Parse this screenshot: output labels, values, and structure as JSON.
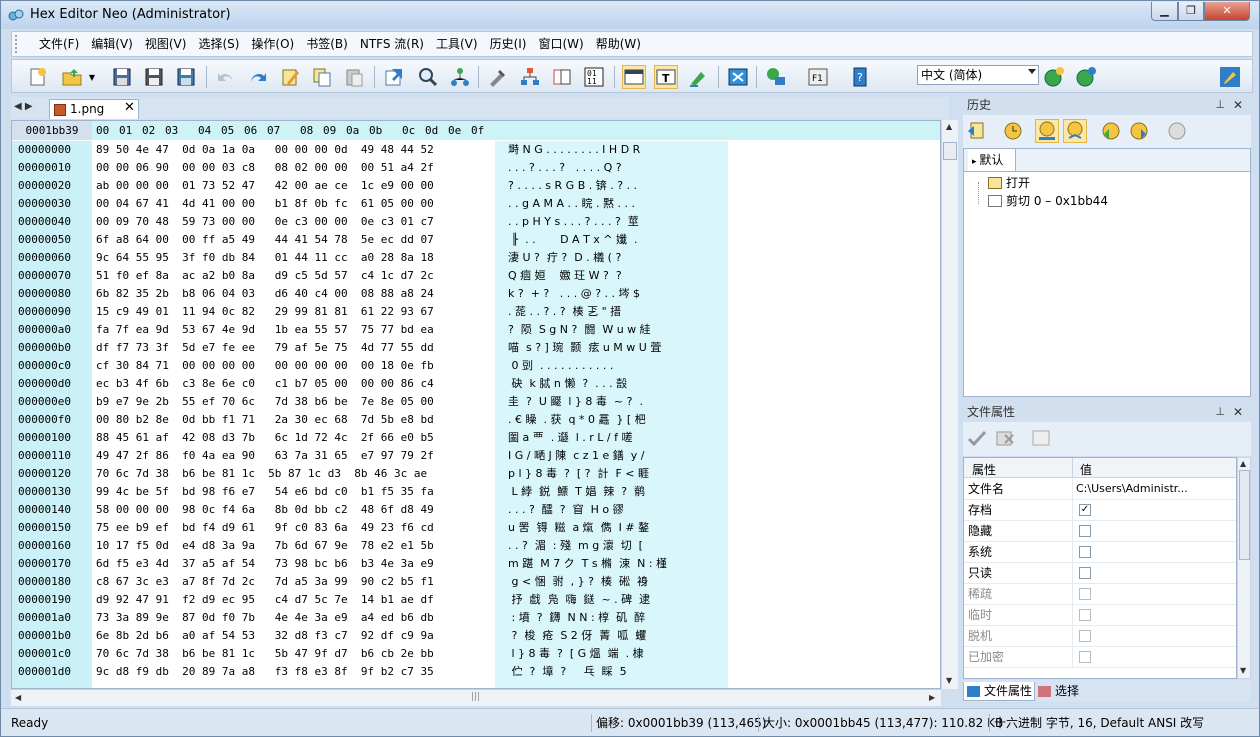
{
  "window": {
    "title": "Hex Editor Neo (Administrator)",
    "min": "0",
    "max": "1",
    "close": "r"
  },
  "menu": [
    "文件(F)",
    "编辑(V)",
    "视图(V)",
    "选择(S)",
    "操作(O)",
    "书签(B)",
    "NTFS 流(R)",
    "工具(V)",
    "历史(I)",
    "窗口(W)",
    "帮助(W)"
  ],
  "toolbar": {
    "language": "中文 (简体)"
  },
  "tab": {
    "file": "1.png"
  },
  "hex": {
    "current_offset": "0001bb39",
    "columns": [
      "00",
      "01",
      "02",
      "03",
      "04",
      "05",
      "06",
      "07",
      "08",
      "09",
      "0a",
      "0b",
      "0c",
      "0d",
      "0e",
      "0f"
    ],
    "rows": [
      {
        "o": "00000000",
        "b": "89 50 4e 47  0d 0a 1a 0a   00 00 00 0d  49 48 44 52",
        "t": "塒 N G . . . . . . . . I H D R"
      },
      {
        "o": "00000010",
        "b": "00 00 06 90  00 00 03 c8   08 02 00 00  00 51 a4 2f",
        "t": ". . . ? . . . ?   . . . . Q ?"
      },
      {
        "o": "00000020",
        "b": "ab 00 00 00  01 73 52 47   42 00 ae ce  1c e9 00 00",
        "t": "? . . . . s R G B . 锛 . ? . ."
      },
      {
        "o": "00000030",
        "b": "00 04 67 41  4d 41 00 00   b1 8f 0b fc  61 05 00 00",
        "t": ". . g A M A . . 睆 . 黙 . . ."
      },
      {
        "o": "00000040",
        "b": "00 09 70 48  59 73 00 00   0e c3 00 00  0e c3 01 c7",
        "t": ". . p H Y s . . . ? . . . ?  莖"
      },
      {
        "o": "00000050",
        "b": "6f a8 64 00  00 ff a5 49   44 41 54 78  5e ec dd 07",
        "t": " ╟  . .       D A T x ^ 孅  ."
      },
      {
        "o": "00000060",
        "b": "9c 64 55 95  3f f0 db 84   01 44 11 cc  a0 28 8a 18",
        "t": "淒 U ?  疔 ?  D . 檥 ( ?"
      },
      {
        "o": "00000070",
        "b": "51 f0 ef 8a  ac a2 b0 8a   d9 c5 5d 57  c4 1c d7 2c",
        "t": "Q 痼 姮    嫐 玨 W ?  ?"
      },
      {
        "o": "00000080",
        "b": "6b 82 35 2b  b8 06 04 03   d6 40 c4 00  08 88 a8 24",
        "t": "k ?  + ?   . . . @ ? . . 埁 $"
      },
      {
        "o": "00000090",
        "b": "15 c9 49 01  11 94 0c 82   29 99 81 81  61 22 93 67",
        "t": ". 蒊 . . ? . ?  楱 乤 \" 搢"
      },
      {
        "o": "000000a0",
        "b": "fa 7f ea 9d  53 67 4e 9d   1b ea 55 57  75 77 bd ea",
        "t": "?  陨  S g N ?  闘  W u w 絓"
      },
      {
        "o": "000000b0",
        "b": "df f7 73 3f  5d e7 fe ee   79 af 5e 75  4d 77 55 dd",
        "t": "喵  s ? ] 琬  颢  痃 u M w U 萓"
      },
      {
        "o": "000000c0",
        "b": "cf 30 84 71  00 00 00 00   00 00 00 00  00 18 0e fb",
        "t": " 0 剅  . . . . . . . . . . ."
      },
      {
        "o": "000000d0",
        "b": "ec b3 4f 6b  c3 8e 6e c0   c1 b7 05 00  00 00 86 c4",
        "t": " 砄  k 脦 n 懒  ?  . . . 嗀"
      },
      {
        "o": "000000e0",
        "b": "b9 e7 9e 2b  55 ef 70 6c   7d 38 b6 be  7e 8e 05 00",
        "t": "圭  ?  U 飋  l } 8 毒  ~ ?  ."
      },
      {
        "o": "000000f0",
        "b": "00 80 b2 8e  0d bb f1 71   2a 30 ec 68  7d 5b e8 bd",
        "t": ". € 矂  . 获  q * 0 靐  } [ 杷"
      },
      {
        "o": "00000100",
        "b": "88 45 61 af  42 08 d3 7b   6c 1d 72 4c  2f 66 e0 b5",
        "t": "圗 a 覀  . 邎  l . r L / f 嗟"
      },
      {
        "o": "00000110",
        "b": "49 47 2f 86  f0 4a ea 90   63 7a 31 65  e7 97 79 2f",
        "t": "I G / 嗮 J 陳  c z 1 e 鐥  y /"
      },
      {
        "o": "00000120",
        "b": "70 6c 7d 38  b6 be 81 1c  5b 87 1c d3  8b 46 3c ae",
        "t": "p l } 8 毒  ?  [ ?  計  F < 睚"
      },
      {
        "o": "00000130",
        "b": "99 4c be 5f  bd 98 f6 e7   54 e6 bd c0  b1 f5 35 fa",
        "t": " L 綍  鋭  鰾  T 娼  辣  ?  鹡"
      },
      {
        "o": "00000140",
        "b": "58 00 00 00  98 0c f4 6a   8b 0d bb c2  48 6f d8 49",
        "t": ". . . ?  醽  ?  窅  H o 豂"
      },
      {
        "o": "00000150",
        "b": "75 ee b9 ef  bd f4 d9 61   9f c0 83 6a  49 23 f6 cd",
        "t": "u 罟  锝  糍  a 熂  儁  I # 鏊"
      },
      {
        "o": "00000160",
        "b": "10 17 f5 0d  e4 d8 3a 9a   7b 6d 67 9e  78 e2 e1 5b",
        "t": ". . ?  湄  : 殘  m g 瀤  切  ["
      },
      {
        "o": "00000170",
        "b": "6d f5 e3 4d  37 a5 af 54   73 98 bc b6  b3 4e 3a e9",
        "t": "m 踸  M 7 ク  T s 樇  涑  N : 槿"
      },
      {
        "o": "00000180",
        "b": "c8 67 3c e3  a7 8f 7d 2c   7d a5 3a 99  90 c2 b5 f1",
        "t": " g < 悃  驸  , } ?  楱  硹  裑"
      },
      {
        "o": "00000190",
        "b": "d9 92 47 91  f2 d9 ec 95   c4 d7 5c 7e  14 b1 ae df",
        "t": " 抒  戱  凫  嗨  鎹  ~ . 碑  逮"
      },
      {
        "o": "000001a0",
        "b": "73 3a 89 9e  87 0d f0 7b   4e 4e 3a e9  a4 ed b6 db",
        "t": " : 墳  ?  鑮  N N : 椁  矶  醉"
      },
      {
        "o": "000001b0",
        "b": "6e 8b 2d b6  a0 af 54 53   32 d8 f3 c7  92 df c9 9a",
        "t": " ?  梭  疮  S 2 伢  菁  呱  蠼"
      },
      {
        "o": "000001c0",
        "b": "70 6c 7d 38  b6 be 81 1c   5b 47 9f d7  b6 cb 2e bb",
        "t": " l } 8 毒  ?  [ G 熅  端  . 棣"
      },
      {
        "o": "000001d0",
        "b": "9c d8 f9 db  20 89 7a a8   f3 f8 e3 8f  9f b2 c7 35",
        "t": " 伫  ?  墇  ?     乓  睬  5"
      }
    ]
  },
  "history": {
    "title": "历史",
    "tab": "默认",
    "items": [
      "打开",
      "剪切 0 – 0x1bb44"
    ]
  },
  "props": {
    "title": "文件属性",
    "col_prop": "属性",
    "col_val": "值",
    "rows": [
      {
        "k": "文件名",
        "v": "C:\\Users\\Administr...",
        "type": "text",
        "dim": false
      },
      {
        "k": "存档",
        "checked": true,
        "type": "check",
        "dim": false
      },
      {
        "k": "隐藏",
        "checked": false,
        "type": "check",
        "dim": false
      },
      {
        "k": "系统",
        "checked": false,
        "type": "check",
        "dim": false
      },
      {
        "k": "只读",
        "checked": false,
        "type": "check",
        "dim": false
      },
      {
        "k": "稀疏",
        "checked": false,
        "type": "check",
        "dim": true
      },
      {
        "k": "临时",
        "checked": false,
        "type": "check",
        "dim": true
      },
      {
        "k": "脱机",
        "checked": false,
        "type": "check",
        "dim": true
      },
      {
        "k": "已加密",
        "checked": false,
        "type": "check",
        "dim": true
      }
    ],
    "tabs": [
      "文件属性",
      "选择"
    ]
  },
  "status": {
    "ready": "Ready",
    "offset": "偏移: 0x0001bb39 (113,465)",
    "size": "大小: 0x0001bb45 (113,477): 110.82 KB",
    "mode": "十六进制 字节, 16, Default ANSI 改写"
  }
}
